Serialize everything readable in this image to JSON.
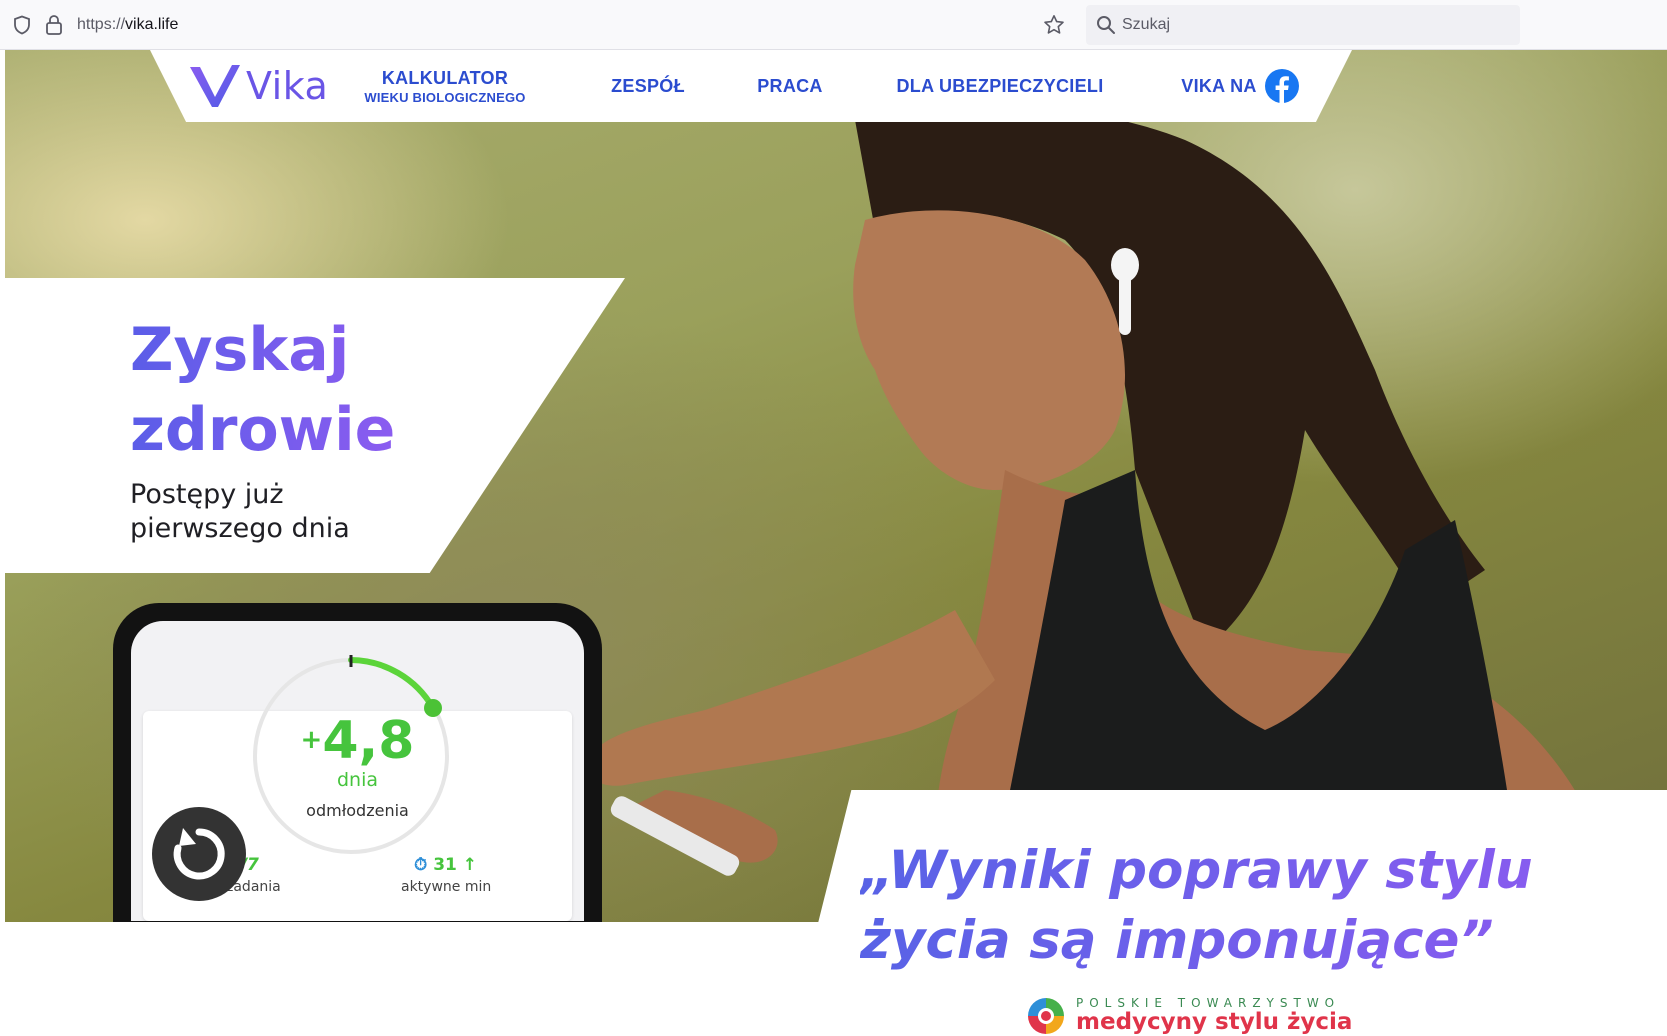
{
  "browser": {
    "url_scheme": "https://",
    "url_host": "vika.life",
    "search_placeholder": "Szukaj"
  },
  "nav": {
    "logo_text": "Vika",
    "items": [
      {
        "label": "KALKULATOR",
        "sublabel": "WIEKU BIOLOGICZNEGO"
      },
      {
        "label": "ZESPÓŁ"
      },
      {
        "label": "PRACA"
      },
      {
        "label": "DLA UBEZPIECZYCIELI"
      },
      {
        "label": "VIKA NA"
      }
    ]
  },
  "hero": {
    "headline_line1": "Zyskaj",
    "headline_line2": "zdrowie",
    "subhead_line1": "Postępy już",
    "subhead_line2": "pierwszego dnia"
  },
  "phone": {
    "gauge_plus": "+",
    "gauge_value": "4,8",
    "gauge_unit": "dnia",
    "gauge_caption": "odmłodzenia",
    "tasks_value": "7/7",
    "tasks_label": "zadania",
    "active_value": "31",
    "active_label": "aktywne min"
  },
  "quote": {
    "line1": "„Wyniki poprawy stylu",
    "line2": "życia są imponujące”"
  },
  "partner": {
    "top": "POLSKIE TOWARZYSTWO",
    "bottom": "medycyny stylu życia"
  },
  "colors": {
    "brand_purple": "#6a55e6",
    "nav_blue": "#2b4ccf",
    "green": "#46c43d",
    "facebook_blue": "#1877f2"
  },
  "icons": [
    "shield-icon",
    "lock-icon",
    "star-icon",
    "search-icon",
    "facebook-icon",
    "replay-icon",
    "stopwatch-icon",
    "arrow-up-icon"
  ]
}
